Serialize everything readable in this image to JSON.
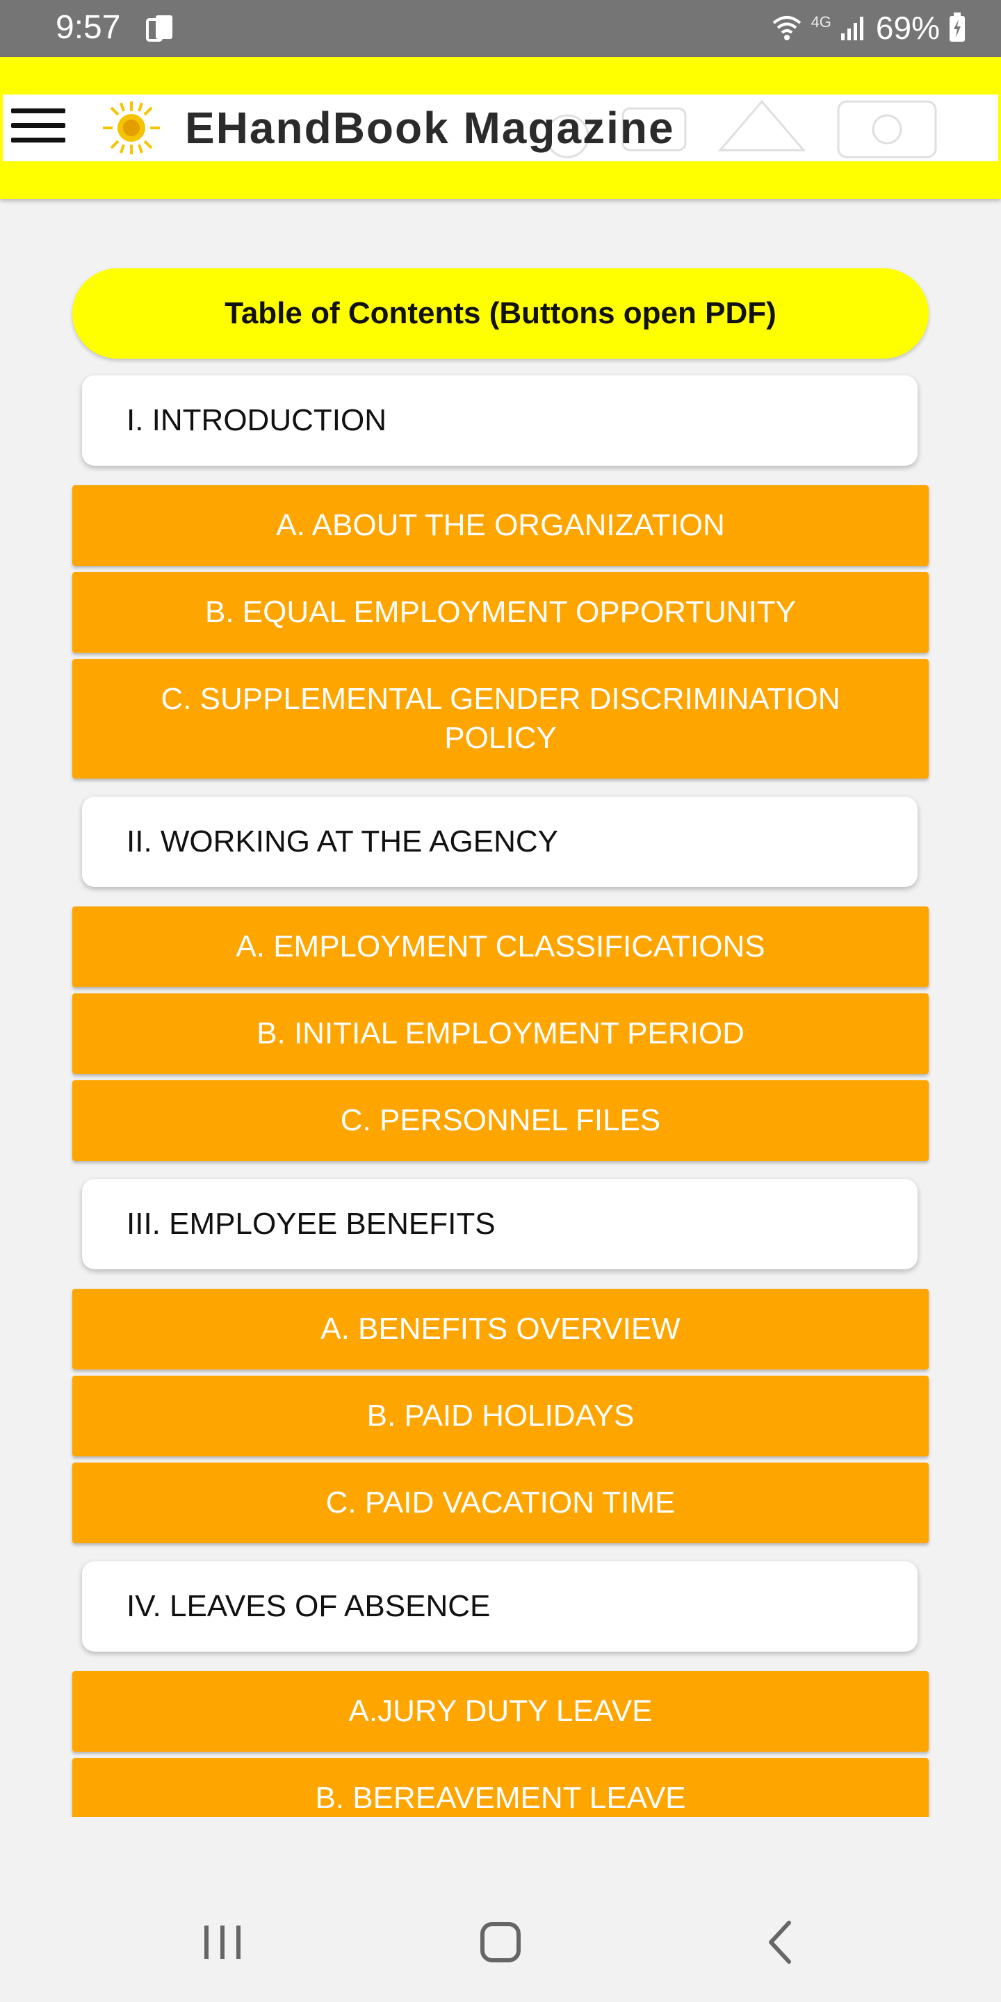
{
  "status_bar": {
    "time": "9:57",
    "network": "4G",
    "battery": "69%"
  },
  "app_bar": {
    "title": "EHandBook Magazine",
    "accent_color": "#ffff00"
  },
  "toc": {
    "title": "Table of Contents (Buttons open PDF)",
    "sections": [
      {
        "label": "I. INTRODUCTION",
        "items": [
          "A. ABOUT THE ORGANIZATION",
          "B. EQUAL EMPLOYMENT OPPORTUNITY",
          "C. SUPPLEMENTAL GENDER DISCRIMINATION POLICY"
        ]
      },
      {
        "label": "II. WORKING AT THE AGENCY",
        "items": [
          "A. EMPLOYMENT CLASSIFICATIONS",
          "B. INITIAL EMPLOYMENT PERIOD",
          "C. PERSONNEL FILES"
        ]
      },
      {
        "label": "III. EMPLOYEE BENEFITS",
        "items": [
          "A. BENEFITS OVERVIEW",
          "B. PAID HOLIDAYS",
          "C. PAID VACATION TIME"
        ]
      },
      {
        "label": "IV. LEAVES OF ABSENCE",
        "items": [
          "A.JURY DUTY LEAVE",
          "B. BEREAVEMENT LEAVE"
        ]
      }
    ],
    "item_color": "#ffa500"
  },
  "nav_bar": {
    "icons": [
      "recent-apps-icon",
      "home-icon",
      "back-icon"
    ]
  }
}
